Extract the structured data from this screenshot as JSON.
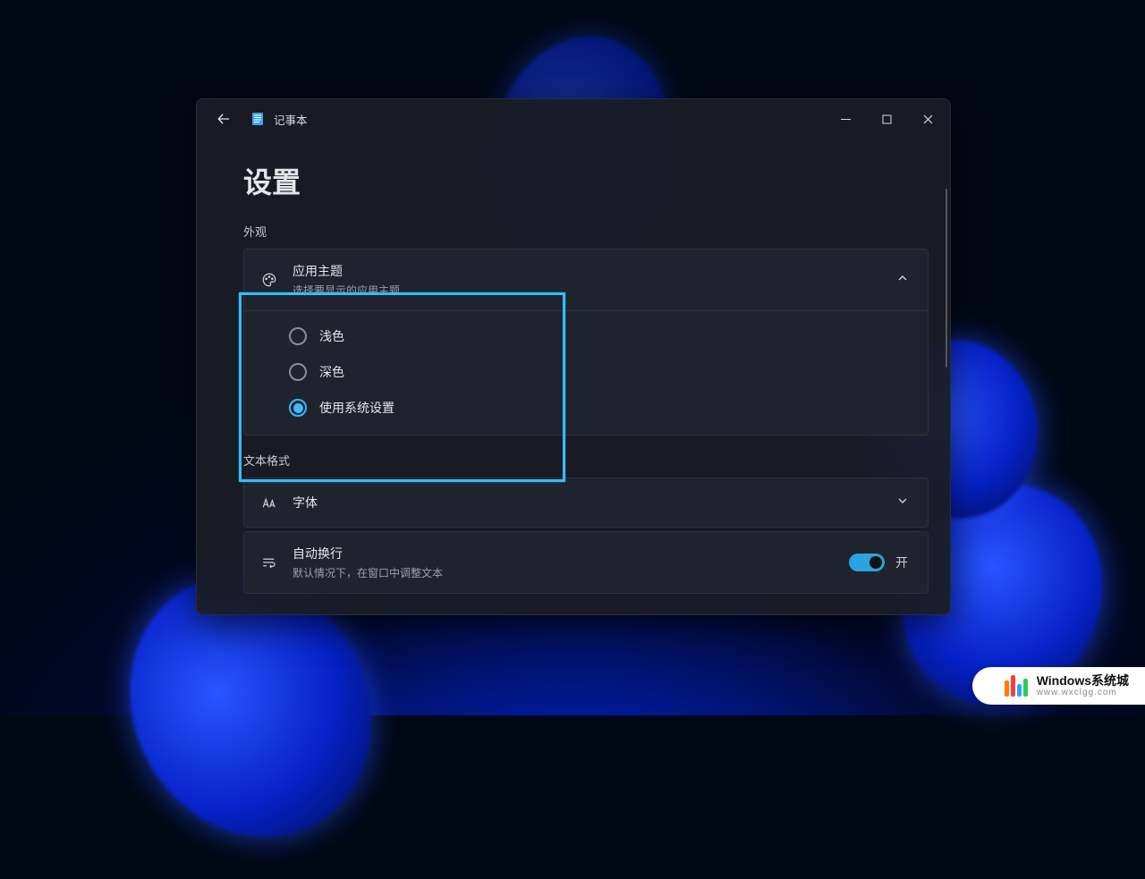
{
  "app": {
    "name": "记事本"
  },
  "page": {
    "title": "设置"
  },
  "sections": {
    "appearance": {
      "label": "外观",
      "theme": {
        "title": "应用主题",
        "subtitle": "选择要显示的应用主题",
        "options": {
          "light": "浅色",
          "dark": "深色",
          "system": "使用系统设置"
        },
        "selected": "system"
      }
    },
    "text": {
      "label": "文本格式",
      "font": {
        "title": "字体"
      },
      "wrap": {
        "title": "自动换行",
        "subtitle": "默认情况下，在窗口中调整文本",
        "state_label": "开"
      }
    }
  },
  "watermark": {
    "title": "Windows系统城",
    "url": "www.wxclgg.com"
  }
}
